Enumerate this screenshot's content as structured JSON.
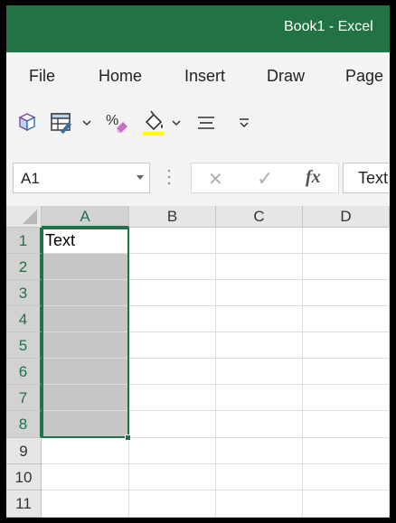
{
  "window": {
    "title": "Book1  -  Excel",
    "accent": "#217346"
  },
  "menu": {
    "items": [
      "File",
      "Home",
      "Insert",
      "Draw",
      "Page"
    ]
  },
  "toolbar": {
    "icons": [
      "format-cells-icon",
      "table-format-icon",
      "percent-format-icon",
      "fill-color-icon",
      "align-icon",
      "more-options-icon"
    ],
    "fill_color": "#ffff00"
  },
  "formula_bar": {
    "name_box": "A1",
    "cancel_symbol": "✕",
    "enter_symbol": "✓",
    "function_symbol": "fx",
    "content": "Text"
  },
  "grid": {
    "columns": [
      "A",
      "B",
      "C",
      "D"
    ],
    "rows": [
      "1",
      "2",
      "3",
      "4",
      "5",
      "6",
      "7",
      "8",
      "9",
      "10",
      "11"
    ],
    "cells": {
      "A1": "Text"
    },
    "selected_range": "A1:A8",
    "active_cell": "A1",
    "selection_color": "#217346",
    "shade_color": "#c6c6c6"
  }
}
